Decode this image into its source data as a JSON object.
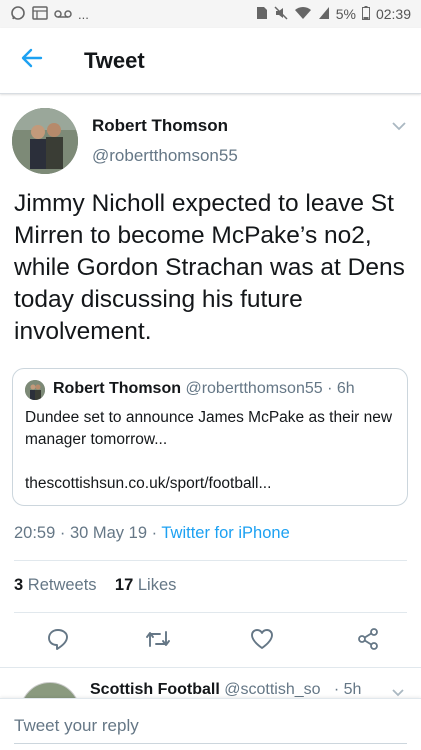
{
  "status_bar": {
    "left_icons": [
      "whatsapp-icon",
      "gallery-icon",
      "voicemail-icon"
    ],
    "more": "...",
    "right_icons": [
      "sim-icon",
      "mute-icon",
      "wifi-icon",
      "signal-icon"
    ],
    "battery": "5%",
    "time": "02:39"
  },
  "header": {
    "title": "Tweet",
    "back_icon": "back-arrow-icon"
  },
  "tweet": {
    "author_name": "Robert Thomson",
    "author_handle": "@robertthomson55",
    "text": "Jimmy Nicholl expected to leave St Mirren to become McPake’s no2, while Gordon Strachan was at Dens today discussing his future involvement.",
    "timestamp": "20:59 · 30 May 19 · ",
    "source": "Twitter for iPhone",
    "retweet_count": "3",
    "retweet_label": " Retweets",
    "like_count": "17",
    "like_label": " Likes"
  },
  "quote": {
    "name": "Robert Thomson",
    "meta": " @robertthomson55 · 6h",
    "text": "Dundee set to announce James McPake as their new manager tomorrow...",
    "link": "thescottishsun.co.uk/sport/football..."
  },
  "actions": [
    "reply-icon",
    "retweet-icon",
    "like-icon",
    "share-icon"
  ],
  "reply_peek": {
    "name": "Scottish Football",
    "meta": " @scottish_so",
    "time": "· 5h"
  },
  "reply_bar": {
    "placeholder": "Tweet your reply"
  },
  "colors": {
    "accent": "#1da1f2",
    "text": "#14171a",
    "muted": "#657786",
    "border": "#e1e8ed"
  }
}
